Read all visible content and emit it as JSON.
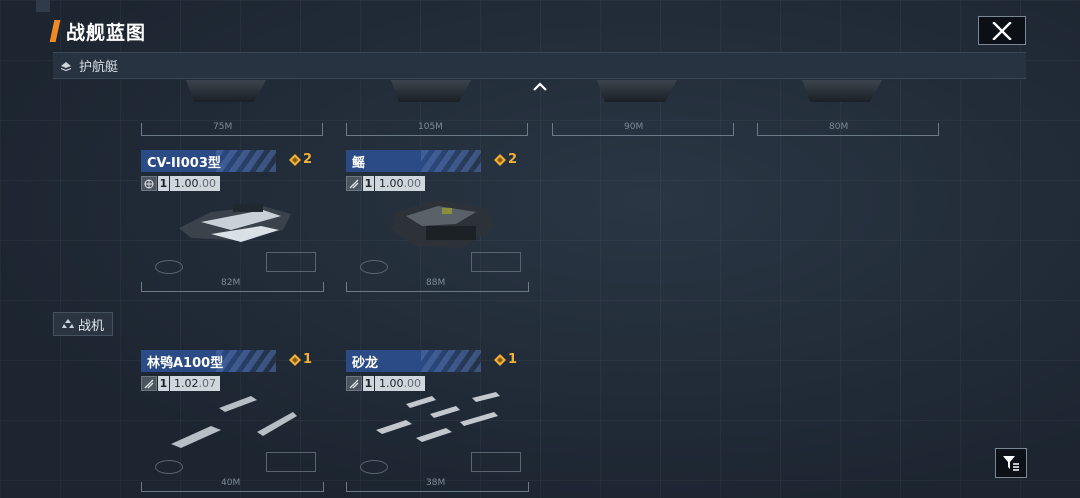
{
  "header": {
    "title": "战舰蓝图"
  },
  "sections": {
    "escort": {
      "label": "护航艇"
    },
    "fighter": {
      "label": "战机"
    }
  },
  "top_row_lengths": [
    "75M",
    "105M",
    "90M",
    "80M"
  ],
  "escort_cards": [
    {
      "name": "CV-II003型",
      "cost": "2",
      "tier": "1",
      "version_main": "1.00",
      "version_sub": ".00",
      "length": "82M",
      "type_icon": "globe-icon"
    },
    {
      "name": "鳐",
      "cost": "2",
      "tier": "1",
      "version_main": "1.00",
      "version_sub": ".00",
      "length": "88M",
      "type_icon": "slash-icon"
    }
  ],
  "fighter_cards": [
    {
      "name": "林鸮A100型",
      "cost": "1",
      "tier": "1",
      "version_main": "1.02",
      "version_sub": ".07",
      "length": "40M",
      "type_icon": "slash-icon"
    },
    {
      "name": "砂龙",
      "cost": "1",
      "tier": "1",
      "version_main": "1.00",
      "version_sub": ".00",
      "length": "38M",
      "type_icon": "slash-icon"
    }
  ],
  "colors": {
    "accent": "#f08a24",
    "name_bar": "#2b4b86",
    "cost": "#f2b134"
  },
  "icons": {
    "close": "close-icon",
    "filter": "filter-icon",
    "chevron": "chevron-up-icon",
    "coin": "coin-icon"
  }
}
